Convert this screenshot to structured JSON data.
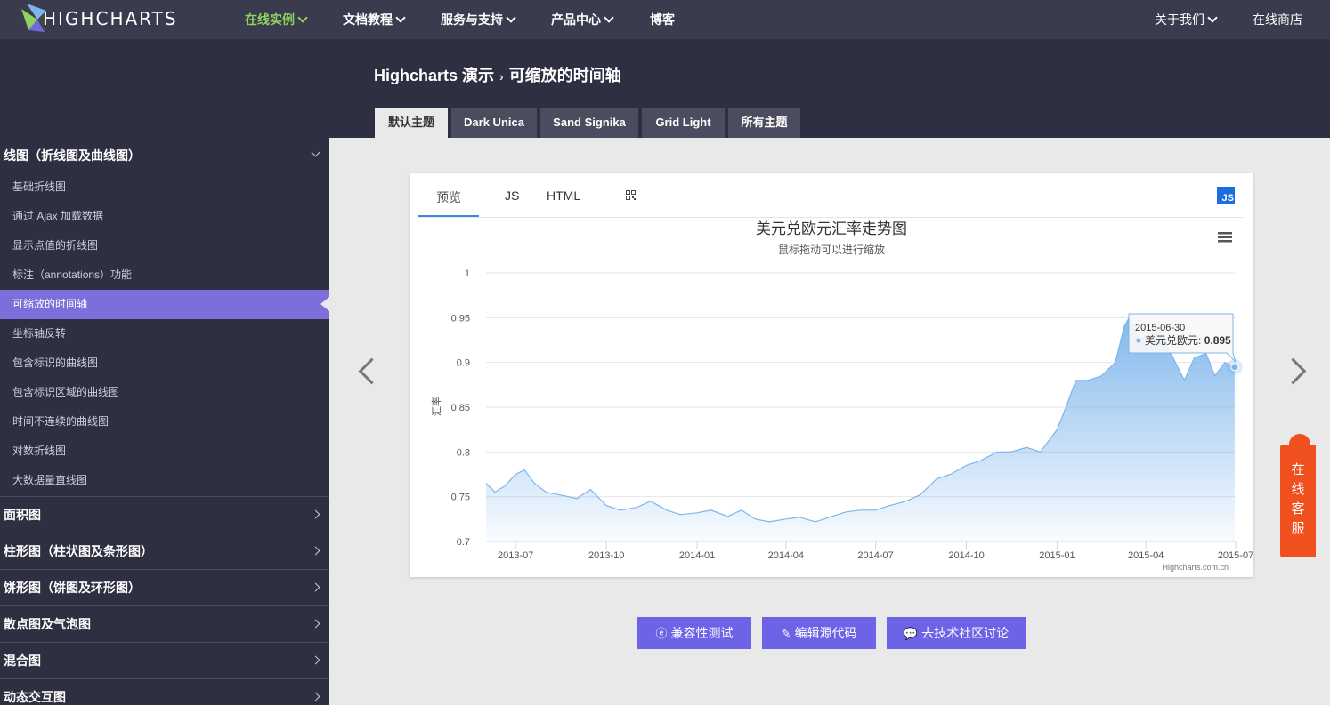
{
  "topnav": {
    "brand": "HIGHCHARTS",
    "items": [
      {
        "label": "在线实例",
        "active": true
      },
      {
        "label": "文档教程"
      },
      {
        "label": "服务与支持"
      },
      {
        "label": "产品中心"
      },
      {
        "label": "博客"
      }
    ],
    "right": [
      {
        "label": "关于我们"
      },
      {
        "label": "在线商店"
      }
    ]
  },
  "header": {
    "crumb_root": "Highcharts 演示",
    "crumb_sep": "›",
    "crumb_current": "可缩放的时间轴",
    "themes": [
      "默认主题",
      "Dark Unica",
      "Sand Signika",
      "Grid Light",
      "所有主题"
    ],
    "active_theme": "默认主题"
  },
  "sidebar": {
    "open_category": "线图（折线图及曲线图）",
    "subitems": [
      "基础折线图",
      "通过 Ajax 加载数据",
      "显示点值的折线图",
      "标注（annotations）功能",
      "可缩放的时间轴",
      "坐标轴反转",
      "包含标识的曲线图",
      "包含标识区域的曲线图",
      "时间不连续的曲线图",
      "对数折线图",
      "大数据量直线图"
    ],
    "active_subitem": "可缩放的时间轴",
    "categories": [
      "面积图",
      "柱形图（柱状图及条形图）",
      "饼形图（饼图及环形图）",
      "散点图及气泡图",
      "混合图",
      "动态交互图"
    ]
  },
  "card": {
    "tabs": [
      "预览",
      "JS",
      "HTML"
    ],
    "active_tab": "预览",
    "badge": "JS",
    "credits": "Highcharts.com.cn"
  },
  "tooltip": {
    "date": "2015-06-30",
    "series": "美元兑欧元",
    "value": "0.895"
  },
  "chart_data": {
    "type": "area",
    "title": "美元兑欧元汇率走势图",
    "subtitle": "鼠标拖动可以进行缩放",
    "ylabel": "汇率",
    "ylim": [
      0.7,
      1
    ],
    "yticks": [
      "0.7",
      "0.75",
      "0.8",
      "0.85",
      "0.9",
      "0.95",
      "1"
    ],
    "xticks": [
      "2013-07",
      "2013-10",
      "2014-01",
      "2014-04",
      "2014-07",
      "2014-10",
      "2015-01",
      "2015-04",
      "2015-07"
    ],
    "xrange": [
      "2013-06-01",
      "2015-07-01"
    ],
    "series": [
      {
        "name": "美元兑欧元",
        "color": "#7cb5ec",
        "x": [
          "2013-06-01",
          "2013-06-10",
          "2013-06-20",
          "2013-07-01",
          "2013-07-10",
          "2013-07-20",
          "2013-08-01",
          "2013-08-15",
          "2013-09-01",
          "2013-09-15",
          "2013-10-01",
          "2013-10-15",
          "2013-11-01",
          "2013-11-15",
          "2013-12-01",
          "2013-12-15",
          "2014-01-01",
          "2014-01-15",
          "2014-02-01",
          "2014-02-15",
          "2014-03-01",
          "2014-03-15",
          "2014-04-01",
          "2014-04-15",
          "2014-05-01",
          "2014-05-15",
          "2014-06-01",
          "2014-06-15",
          "2014-07-01",
          "2014-07-15",
          "2014-08-01",
          "2014-08-15",
          "2014-09-01",
          "2014-09-15",
          "2014-10-01",
          "2014-10-15",
          "2014-11-01",
          "2014-11-15",
          "2014-12-01",
          "2014-12-15",
          "2015-01-01",
          "2015-01-10",
          "2015-01-20",
          "2015-02-01",
          "2015-02-15",
          "2015-03-01",
          "2015-03-10",
          "2015-03-15",
          "2015-03-25",
          "2015-04-01",
          "2015-04-10",
          "2015-04-20",
          "2015-05-01",
          "2015-05-10",
          "2015-05-20",
          "2015-06-01",
          "2015-06-10",
          "2015-06-20",
          "2015-06-30"
        ],
        "values": [
          0.765,
          0.755,
          0.762,
          0.775,
          0.78,
          0.765,
          0.755,
          0.752,
          0.748,
          0.758,
          0.74,
          0.735,
          0.738,
          0.745,
          0.735,
          0.73,
          0.732,
          0.735,
          0.728,
          0.735,
          0.725,
          0.722,
          0.725,
          0.727,
          0.722,
          0.727,
          0.733,
          0.735,
          0.735,
          0.74,
          0.745,
          0.752,
          0.77,
          0.775,
          0.785,
          0.79,
          0.8,
          0.8,
          0.805,
          0.8,
          0.825,
          0.85,
          0.88,
          0.88,
          0.885,
          0.9,
          0.94,
          0.95,
          0.925,
          0.93,
          0.945,
          0.925,
          0.9,
          0.88,
          0.905,
          0.91,
          0.885,
          0.9,
          0.895
        ]
      }
    ],
    "grid": true,
    "legend": false
  },
  "buttons": [
    "兼容性测试",
    "编辑源代码",
    "去技术社区讨论"
  ],
  "service": {
    "label": "在线客服"
  }
}
